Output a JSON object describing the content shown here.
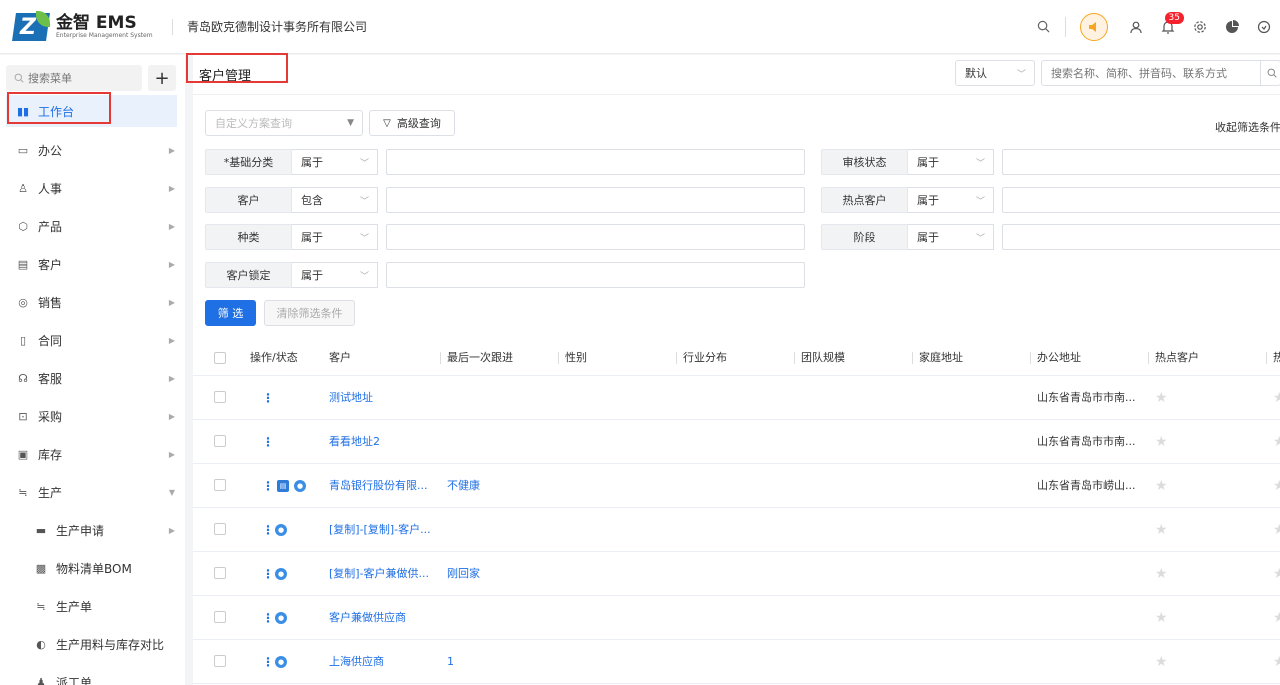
{
  "header": {
    "logo_title": "金智 EMS",
    "logo_subtitle": "Enterprise Management System",
    "company": "青岛欧克德制设计事务所有限公司",
    "notification_count": "35"
  },
  "sidebar": {
    "search_placeholder": "搜索菜单",
    "add_label": "+",
    "items": [
      {
        "label": "工作台",
        "icon": "dashboard-icon"
      },
      {
        "label": "办公",
        "icon": "office-icon"
      },
      {
        "label": "人事",
        "icon": "people-icon"
      },
      {
        "label": "产品",
        "icon": "product-icon"
      },
      {
        "label": "客户",
        "icon": "customer-icon"
      },
      {
        "label": "销售",
        "icon": "sales-icon"
      },
      {
        "label": "合同",
        "icon": "contract-icon"
      },
      {
        "label": "客服",
        "icon": "service-icon"
      },
      {
        "label": "采购",
        "icon": "purchase-icon"
      },
      {
        "label": "库存",
        "icon": "inventory-icon"
      },
      {
        "label": "生产",
        "icon": "production-icon"
      }
    ],
    "sub_items": [
      {
        "label": "生产申请",
        "icon": "folder-icon"
      },
      {
        "label": "物料清单BOM",
        "icon": "list-icon"
      },
      {
        "label": "生产单",
        "icon": "order-icon"
      },
      {
        "label": "生产用料与库存对比",
        "icon": "half-circle-icon"
      },
      {
        "label": "派工单",
        "icon": "worker-icon"
      }
    ]
  },
  "main": {
    "title": "客户管理",
    "sort_value": "默认",
    "search_placeholder": "搜索名称、简称、拼音码、联系方式",
    "custom_query_placeholder": "自定义方案查询",
    "advanced_query": "高级查询",
    "collapse": "收起筛选条件",
    "filters_left": [
      {
        "label": "*基础分类",
        "op": "属于"
      },
      {
        "label": "客户",
        "op": "包含"
      },
      {
        "label": "种类",
        "op": "属于"
      },
      {
        "label": "客户锁定",
        "op": "属于"
      }
    ],
    "filters_right": [
      {
        "label": "审核状态",
        "op": "属于"
      },
      {
        "label": "热点客户",
        "op": "属于"
      },
      {
        "label": "阶段",
        "op": "属于"
      }
    ],
    "filter_button": "筛 选",
    "clear_button": "清除筛选条件",
    "columns": [
      "操作/状态",
      "客户",
      "最后一次跟进",
      "性别",
      "行业分布",
      "团队规模",
      "家庭地址",
      "办公地址",
      "热点客户",
      "热"
    ],
    "rows": [
      {
        "customer": "测试地址",
        "follow": "",
        "office": "山东省青岛市市南...",
        "icons": 0
      },
      {
        "customer": "看看地址2",
        "follow": "",
        "office": "山东省青岛市市南...",
        "icons": 0
      },
      {
        "customer": "青岛银行股份有限...",
        "follow": "不健康",
        "office": "山东省青岛市崂山...",
        "icons": 2
      },
      {
        "customer": "[复制]-[复制]-客户...",
        "follow": "",
        "office": "",
        "icons": 1
      },
      {
        "customer": "[复制]-客户兼做供...",
        "follow": "刚回家",
        "office": "",
        "icons": 1
      },
      {
        "customer": "客户兼做供应商",
        "follow": "",
        "office": "",
        "icons": 1
      },
      {
        "customer": "上海供应商",
        "follow": "1",
        "office": "",
        "icons": 1
      }
    ]
  }
}
